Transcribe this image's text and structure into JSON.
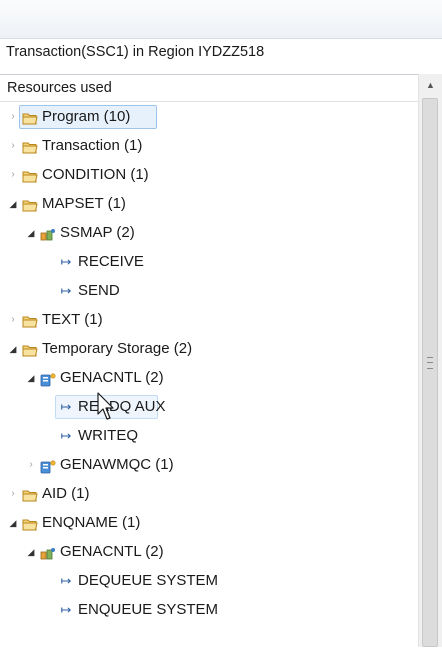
{
  "title": "Transaction(SSC1) in Region IYDZZ518",
  "column_header": "Resources used",
  "tree": [
    {
      "label": "Program  (10)",
      "type": "folder",
      "state": "collapsed",
      "depth": 0,
      "selected": true
    },
    {
      "label": "Transaction  (1)",
      "type": "folder",
      "state": "collapsed",
      "depth": 0
    },
    {
      "label": "CONDITION  (1)",
      "type": "folder",
      "state": "collapsed",
      "depth": 0
    },
    {
      "label": "MAPSET  (1)",
      "type": "folder",
      "state": "expanded",
      "depth": 0
    },
    {
      "label": "SSMAP (2)",
      "type": "resource",
      "state": "expanded",
      "depth": 1
    },
    {
      "label": "RECEIVE",
      "type": "operation",
      "depth": 2
    },
    {
      "label": "SEND",
      "type": "operation",
      "depth": 2
    },
    {
      "label": "TEXT  (1)",
      "type": "folder",
      "state": "collapsed",
      "depth": 0
    },
    {
      "label": "Temporary Storage  (2)",
      "type": "folder",
      "state": "expanded",
      "depth": 0
    },
    {
      "label": "GENACNTL (2)",
      "type": "queue",
      "state": "expanded",
      "depth": 1
    },
    {
      "label": "READQ AUX",
      "type": "operation",
      "depth": 2,
      "hovered": true
    },
    {
      "label": "WRITEQ",
      "type": "operation",
      "depth": 2
    },
    {
      "label": "GENAWMQC (1)",
      "type": "queue",
      "state": "collapsed",
      "depth": 1
    },
    {
      "label": "AID  (1)",
      "type": "folder",
      "state": "collapsed",
      "depth": 0
    },
    {
      "label": "ENQNAME  (1)",
      "type": "folder",
      "state": "expanded",
      "depth": 0
    },
    {
      "label": "GENACNTL (2)",
      "type": "resource",
      "state": "expanded",
      "depth": 1
    },
    {
      "label": "DEQUEUE SYSTEM",
      "type": "operation",
      "depth": 2
    },
    {
      "label": "ENQUEUE SYSTEM",
      "type": "operation",
      "depth": 2
    }
  ],
  "icons": {
    "folder": "folder-icon",
    "resource": "resource-icon",
    "queue": "ts-queue-icon",
    "operation": "arrow-right-icon"
  },
  "colors": {
    "selection_bg": "#e6f1fc",
    "selection_border": "#9fc4ea",
    "folder": "#e8b84a"
  }
}
